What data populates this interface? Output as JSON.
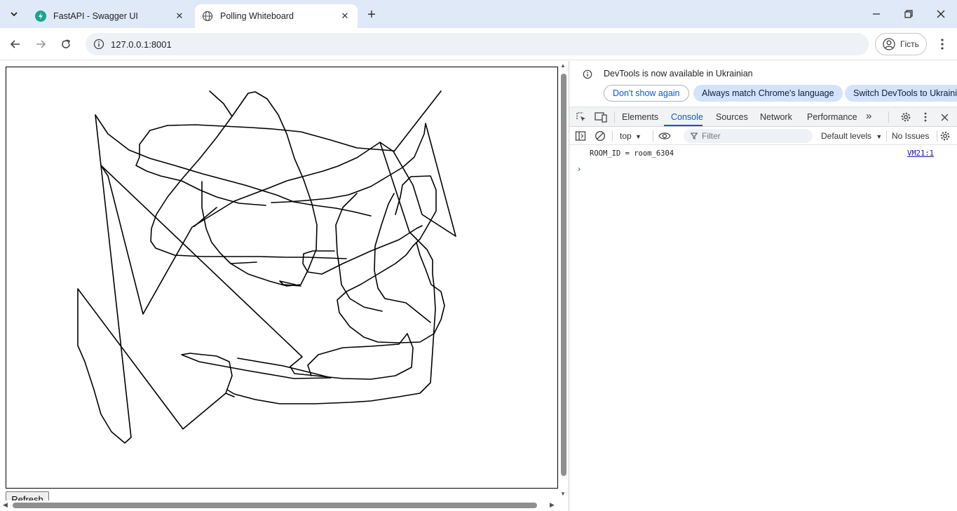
{
  "browser": {
    "tabs": [
      {
        "title": "FastAPI - Swagger UI",
        "active": false,
        "favicon": "fastapi-icon",
        "favicon_color": "#1aa48b"
      },
      {
        "title": "Polling Whiteboard",
        "active": true,
        "favicon": "globe-icon"
      }
    ],
    "new_tab_label": "+",
    "url": "127.0.0.1:8001",
    "profile_label": "Гість"
  },
  "page": {
    "refresh_label": "Refresh",
    "canvas_description": "Whiteboard canvas with freehand black strokes"
  },
  "devtools": {
    "info_message": "DevTools is now available in Ukrainian",
    "info_buttons": [
      "Don't show again",
      "Always match Chrome's language",
      "Switch DevTools to Ukrainian"
    ],
    "tabs": [
      "Elements",
      "Console",
      "Sources",
      "Network",
      "Performance"
    ],
    "active_tab": "Console",
    "more_tabs": "»",
    "context": "top",
    "filter_placeholder": "Filter",
    "levels": "Default levels",
    "issues": "No Issues",
    "console": {
      "messages": [
        {
          "text": "ROOM_ID = room_6304",
          "source": "VM21:1"
        }
      ],
      "prompt": "›"
    }
  },
  "colors": {
    "tabstrip": "#dfe9f7",
    "accent": "#0b57d0",
    "pill": "#d3e3fd"
  }
}
